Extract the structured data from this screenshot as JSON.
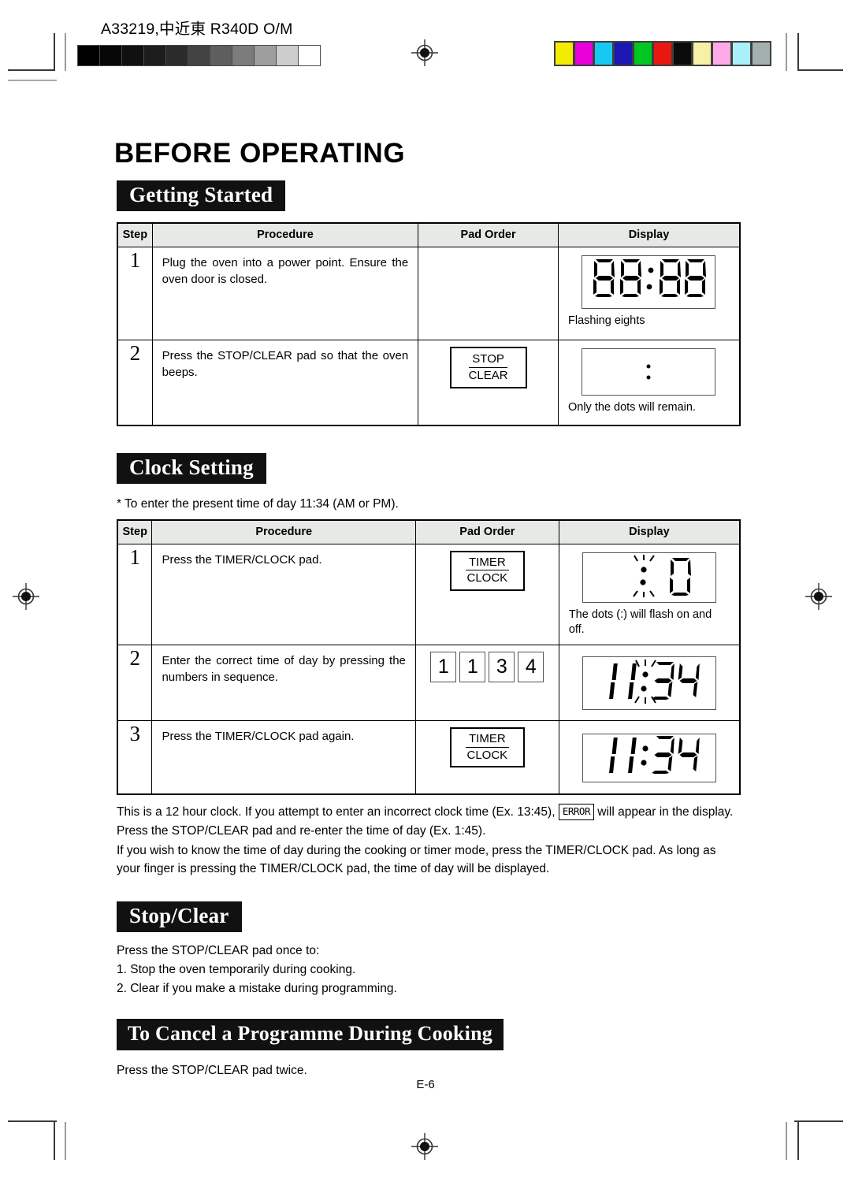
{
  "print_marks": {
    "code_line": "A33219,中近東 R340D O/M",
    "grey_wedge": [
      "#000000",
      "#070707",
      "#101010",
      "#1d1d1d",
      "#2b2b2b",
      "#434343",
      "#5e5e5e",
      "#7c7c7c",
      "#9e9e9e",
      "#cdcdcd",
      "#ffffff"
    ],
    "color_bar": [
      "#f2ed00",
      "#ea00d8",
      "#17c8f2",
      "#1b17b5",
      "#00c624",
      "#e8170f",
      "#0b0b0b",
      "#f7f1a5",
      "#ffaae8",
      "#aaf0fb",
      "#a4b0ae"
    ],
    "registration_icon": "registration-target-icon"
  },
  "page": {
    "title": "BEFORE OPERATING",
    "number": "E-6"
  },
  "sections": {
    "getting_started": {
      "heading": "Getting Started",
      "table": {
        "headers": [
          "Step",
          "Procedure",
          "Pad Order",
          "Display"
        ],
        "rows": [
          {
            "step": "1",
            "procedure": "Plug the oven into a power point. Ensure the oven door is closed.",
            "pad": null,
            "display_value": "88:88",
            "display_caption": "Flashing  eights"
          },
          {
            "step": "2",
            "procedure": "Press the STOP/CLEAR pad so that the oven beeps.",
            "pad": {
              "top": "STOP",
              "bottom": "CLEAR"
            },
            "display_value": "dots-only",
            "display_caption": "Only the dots will remain."
          }
        ]
      }
    },
    "clock_setting": {
      "heading": "Clock Setting",
      "note": "* To enter the present time of day 11:34 (AM or PM).",
      "table": {
        "headers": [
          "Step",
          "Procedure",
          "Pad Order",
          "Display"
        ],
        "rows": [
          {
            "step": "1",
            "procedure": "Press the TIMER/CLOCK pad.",
            "pad": {
              "top": "TIMER",
              "bottom": "CLOCK"
            },
            "display_value": "0",
            "display_flash": true,
            "display_caption": "The dots (:) will flash on and off."
          },
          {
            "step": "2",
            "procedure": "Enter the correct  time of day  by pressing the numbers in sequence.",
            "numpads": [
              "1",
              "1",
              "3",
              "4"
            ],
            "display_value": "11:34",
            "display_flash": true,
            "display_caption": ""
          },
          {
            "step": "3",
            "procedure": "Press the TIMER/CLOCK pad again.",
            "pad": {
              "top": "TIMER",
              "bottom": "CLOCK"
            },
            "display_value": "11:34",
            "display_flash": false,
            "display_caption": ""
          }
        ]
      },
      "paragraph_1a": "This is a 12 hour clock. If you attempt to enter an incorrect clock time (Ex. 13:45),",
      "paragraph_1_error": "ERROR",
      "paragraph_1b": "will appear in the display. Press the STOP/CLEAR pad and re-enter the time of day  (Ex. 1:45).",
      "paragraph_2": "If you wish to know the time of day during the cooking or timer mode, press the TIMER/CLOCK pad. As long as your finger is pressing the TIMER/CLOCK pad, the time of day will be displayed."
    },
    "stop_clear": {
      "heading": "Stop/Clear",
      "intro": "Press the STOP/CLEAR pad once to:",
      "items": [
        "1.  Stop the oven temporarily during cooking.",
        "2.  Clear if you make a mistake during programming."
      ]
    },
    "cancel_programme": {
      "heading": "To Cancel a Programme During Cooking",
      "text": "Press the STOP/CLEAR pad twice."
    }
  }
}
